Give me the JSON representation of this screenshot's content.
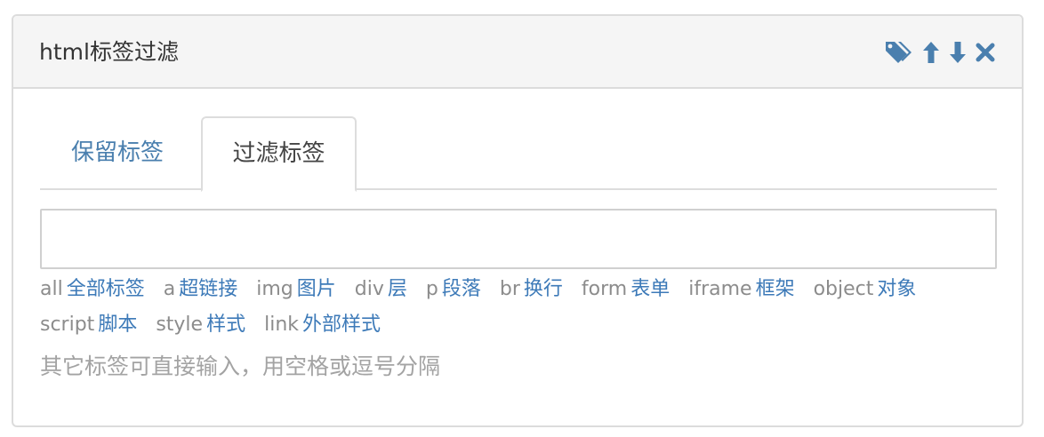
{
  "panel": {
    "title": "html标签过滤",
    "tools": [
      {
        "name": "tags-icon"
      },
      {
        "name": "arrow-up-icon"
      },
      {
        "name": "arrow-down-icon"
      },
      {
        "name": "close-icon"
      }
    ]
  },
  "colors": {
    "accent": "#4a7fae",
    "tag_name": "#3d7ab8",
    "tag_code": "#8c8c8c",
    "hint": "#a3a3a3"
  },
  "tabs": [
    {
      "label": "保留标签",
      "active": false
    },
    {
      "label": "过滤标签",
      "active": true
    }
  ],
  "input": {
    "value": "",
    "placeholder": ""
  },
  "tags": [
    {
      "code": "all",
      "name": "全部标签"
    },
    {
      "code": "a",
      "name": "超链接"
    },
    {
      "code": "img",
      "name": "图片"
    },
    {
      "code": "div",
      "name": "层"
    },
    {
      "code": "p",
      "name": "段落"
    },
    {
      "code": "br",
      "name": "换行"
    },
    {
      "code": "form",
      "name": "表单"
    },
    {
      "code": "iframe",
      "name": "框架"
    },
    {
      "code": "object",
      "name": "对象"
    },
    {
      "code": "script",
      "name": "脚本"
    },
    {
      "code": "style",
      "name": "样式"
    },
    {
      "code": "link",
      "name": "外部样式"
    }
  ],
  "hint": "其它标签可直接输入，用空格或逗号分隔"
}
